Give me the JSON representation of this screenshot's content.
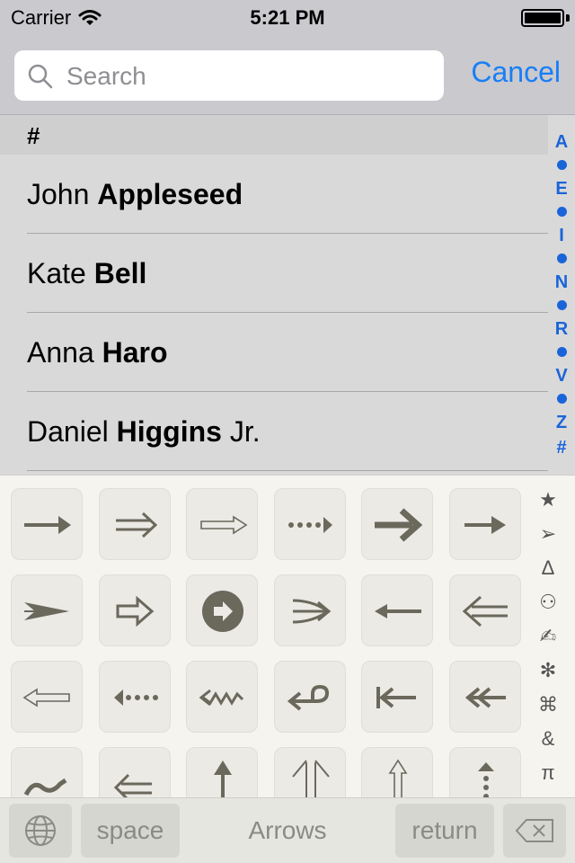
{
  "status_bar": {
    "carrier": "Carrier",
    "time": "5:21 PM"
  },
  "search": {
    "placeholder": "Search",
    "cancel_label": "Cancel"
  },
  "contacts": {
    "section_header": "#",
    "rows": [
      {
        "first": "John",
        "last": "Appleseed",
        "suffix": ""
      },
      {
        "first": "Kate",
        "last": "Bell",
        "suffix": ""
      },
      {
        "first": "Anna",
        "last": "Haro",
        "suffix": ""
      },
      {
        "first": "Daniel",
        "last": "Higgins",
        "suffix": "Jr."
      }
    ]
  },
  "index_bar": [
    "A",
    "E",
    "I",
    "N",
    "R",
    "V",
    "Z",
    "#"
  ],
  "keyboard": {
    "category_name": "Arrows",
    "space_label": "space",
    "return_label": "return",
    "categories": [
      "★",
      "➢",
      "Δ",
      "⚇",
      "✍",
      "✻",
      "⌘",
      "&",
      "π"
    ]
  },
  "colors": {
    "accent": "#1a7ef5",
    "index": "#1a64d9",
    "glyph": "#6b685c"
  }
}
